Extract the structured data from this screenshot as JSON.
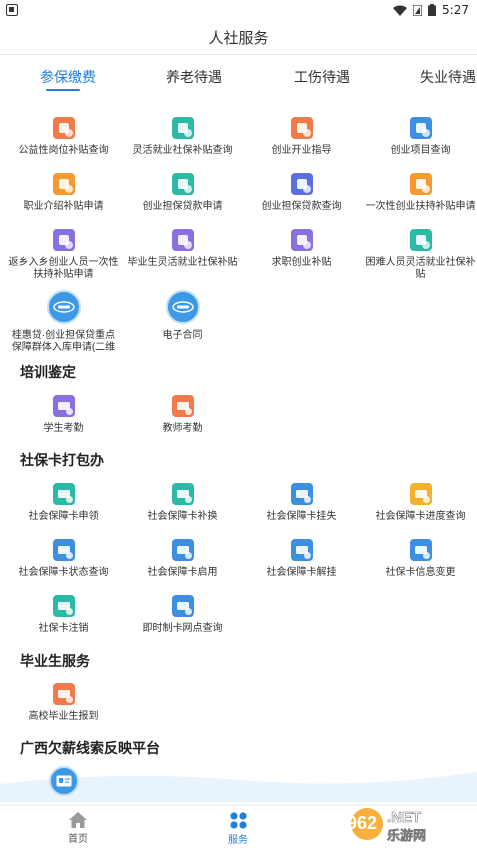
{
  "status_bar": {
    "time": "5:27"
  },
  "title": "人社服务",
  "tabs": [
    {
      "label": "参保缴费",
      "active": true
    },
    {
      "label": "养老待遇",
      "active": false
    },
    {
      "label": "工伤待遇",
      "active": false
    },
    {
      "label": "失业待遇",
      "active": false
    }
  ],
  "services": [
    {
      "label": "公益性岗位补贴查询",
      "icon": "coins-icon",
      "color": "#f07a4a"
    },
    {
      "label": "灵活就业社保补贴查询",
      "icon": "money-bag-icon",
      "color": "#2db9a8"
    },
    {
      "label": "创业开业指导",
      "icon": "book-icon",
      "color": "#f07a4a"
    },
    {
      "label": "创业项目查询",
      "icon": "briefcase-search-icon",
      "color": "#3d8fe0"
    },
    {
      "label": "职业介绍补贴申请",
      "icon": "person-chat-icon",
      "color": "#f59a2e"
    },
    {
      "label": "创业担保贷款申请",
      "icon": "loan-bag-icon",
      "color": "#2db9a8"
    },
    {
      "label": "创业担保贷款查询",
      "icon": "loan-search-icon",
      "color": "#5b6fe0"
    },
    {
      "label": "一次性创业扶持补贴申请",
      "icon": "subsidy-doc-icon",
      "color": "#f59a2e"
    },
    {
      "label": "返乡入乡创业人员一次性扶持补贴申请",
      "icon": "return-doc-icon",
      "color": "#8a6fe0"
    },
    {
      "label": "毕业生灵活就业社保补贴",
      "icon": "graduate-doc-icon",
      "color": "#8a6fe0"
    },
    {
      "label": "求职创业补贴",
      "icon": "job-bag-icon",
      "color": "#8a6fe0"
    },
    {
      "label": "困难人员灵活就业社保补贴",
      "icon": "hardship-doc-icon",
      "color": "#2db9a8"
    },
    {
      "label": "桂惠贷·创业担保贷重点保障群体入库申请(二维",
      "icon": "guihuidai-icon",
      "color": "#3d99e6"
    },
    {
      "label": "电子合同",
      "icon": "e-contract-icon",
      "color": "#3d99e6"
    }
  ],
  "sections": [
    {
      "title": "培训鉴定",
      "items": [
        {
          "label": "学生考勤",
          "icon": "student-attendance-icon",
          "color": "#8a6fe0"
        },
        {
          "label": "教师考勤",
          "icon": "teacher-attendance-icon",
          "color": "#f07a4a"
        }
      ]
    },
    {
      "title": "社保卡打包办",
      "items": [
        {
          "label": "社会保障卡申领",
          "icon": "card-apply-icon",
          "color": "#2db9a8"
        },
        {
          "label": "社会保障卡补换",
          "icon": "card-replace-icon",
          "color": "#2db9a8"
        },
        {
          "label": "社会保障卡挂失",
          "icon": "card-loss-icon",
          "color": "#3d8fe0"
        },
        {
          "label": "社会保障卡进度查询",
          "icon": "card-progress-icon",
          "color": "#f5b02e"
        },
        {
          "label": "社会保障卡状态查询",
          "icon": "card-status-icon",
          "color": "#3d8fe0"
        },
        {
          "label": "社会保障卡启用",
          "icon": "card-activate-icon",
          "color": "#3d8fe0"
        },
        {
          "label": "社会保障卡解挂",
          "icon": "card-unlock-icon",
          "color": "#3d8fe0"
        },
        {
          "label": "社保卡信息变更",
          "icon": "card-info-change-icon",
          "color": "#3d8fe0"
        },
        {
          "label": "社保卡注销",
          "icon": "card-cancel-icon",
          "color": "#2db9a8"
        },
        {
          "label": "即时制卡网点查询",
          "icon": "map-pin-icon",
          "color": "#3d8fe0"
        }
      ]
    },
    {
      "title": "毕业生服务",
      "items": [
        {
          "label": "高校毕业生报到",
          "icon": "graduate-report-icon",
          "color": "#f07a4a"
        }
      ]
    },
    {
      "title": "广西欠薪线索反映平台",
      "items": []
    }
  ],
  "bottom_nav": [
    {
      "label": "首页",
      "icon": "home-icon",
      "active": false
    },
    {
      "label": "服务",
      "icon": "services-icon",
      "active": true
    }
  ],
  "watermark": {
    "brand": "962.NET",
    "sub": "乐游网"
  },
  "colors": {
    "accent": "#1f7fd9",
    "text": "#333333"
  }
}
